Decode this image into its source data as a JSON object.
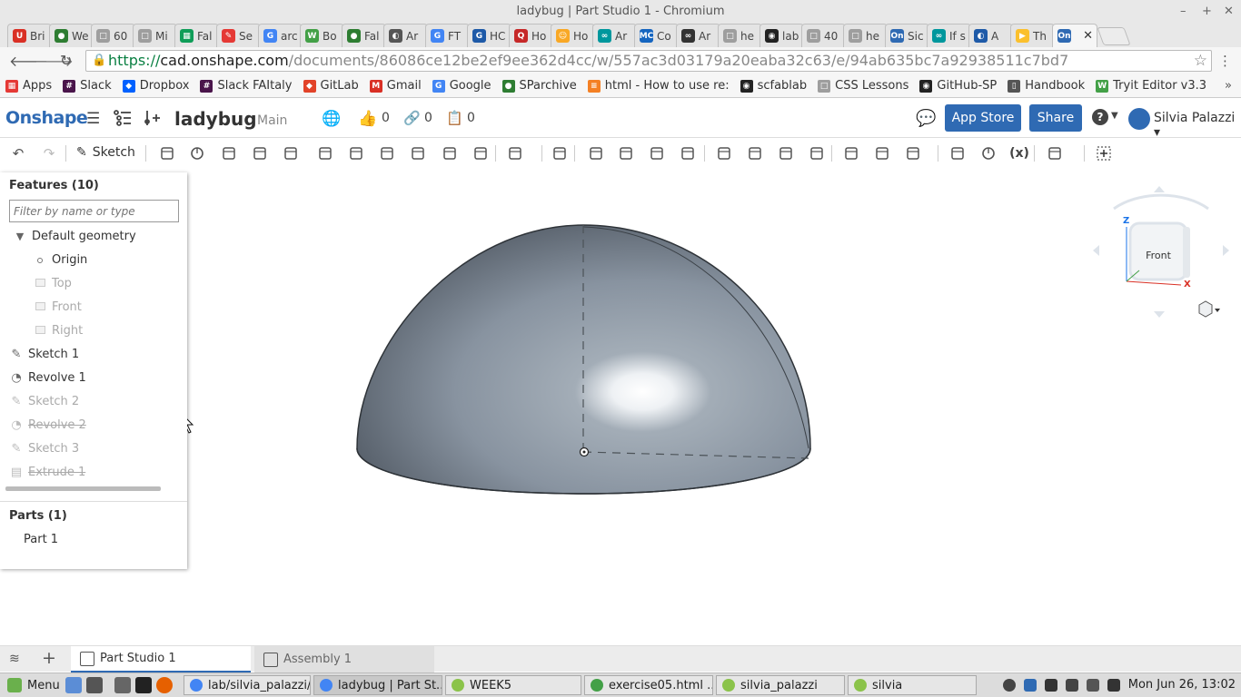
{
  "window": {
    "title": "ladybug | Part Studio 1 - Chromium"
  },
  "tabs": [
    {
      "label": "Bri",
      "color": "#d93025",
      "glyph": "U"
    },
    {
      "label": "We",
      "color": "#2e7d32",
      "glyph": "●"
    },
    {
      "label": "60",
      "color": "#9e9e9e",
      "glyph": "□"
    },
    {
      "label": "Mi",
      "color": "#9e9e9e",
      "glyph": "□"
    },
    {
      "label": "Fal",
      "color": "#0f9d58",
      "glyph": "▦"
    },
    {
      "label": "Se",
      "color": "#e53935",
      "glyph": "✎"
    },
    {
      "label": "arc",
      "color": "#4285f4",
      "glyph": "G"
    },
    {
      "label": "Bo",
      "color": "#43a047",
      "glyph": "W"
    },
    {
      "label": "Fal",
      "color": "#2e7d32",
      "glyph": "●"
    },
    {
      "label": "Ar",
      "color": "#555555",
      "glyph": "◐"
    },
    {
      "label": "FT",
      "color": "#4285f4",
      "glyph": "G"
    },
    {
      "label": "HC",
      "color": "#1e5aa8",
      "glyph": "G"
    },
    {
      "label": "Ho",
      "color": "#c62828",
      "glyph": "Q"
    },
    {
      "label": "Ho",
      "color": "#f9a825",
      "glyph": "☺"
    },
    {
      "label": "Ar",
      "color": "#00979d",
      "glyph": "∞"
    },
    {
      "label": "Co",
      "color": "#1565c0",
      "glyph": "MC"
    },
    {
      "label": "Ar",
      "color": "#333333",
      "glyph": "∞"
    },
    {
      "label": "he",
      "color": "#9e9e9e",
      "glyph": "□"
    },
    {
      "label": "lab",
      "color": "#222222",
      "glyph": "◉"
    },
    {
      "label": "40",
      "color": "#9e9e9e",
      "glyph": "□"
    },
    {
      "label": "he",
      "color": "#9e9e9e",
      "glyph": "□"
    },
    {
      "label": "Sic",
      "color": "#2f6ab3",
      "glyph": "On"
    },
    {
      "label": "If s",
      "color": "#00979d",
      "glyph": "∞"
    },
    {
      "label": "A",
      "color": "#1e5aa8",
      "glyph": "◐"
    },
    {
      "label": "Th",
      "color": "#fbc02d",
      "glyph": "▶"
    },
    {
      "label": "",
      "color": "#2f6ab3",
      "glyph": "On",
      "active": true
    }
  ],
  "address": {
    "scheme": "https://",
    "host": "cad.onshape.com",
    "path": "/documents/86086ce12be2ef9ee362d4cc/w/557ac3d03179a20eaba32c63/e/94ab635bc7a92938511c7bd7"
  },
  "bookmarks": [
    {
      "label": "Apps",
      "color": "#e53935",
      "glyph": "▦"
    },
    {
      "label": "Slack",
      "color": "#4a154b",
      "glyph": "#"
    },
    {
      "label": "Dropbox",
      "color": "#0061ff",
      "glyph": "◆"
    },
    {
      "label": "Slack FAItaly",
      "color": "#4a154b",
      "glyph": "#"
    },
    {
      "label": "GitLab",
      "color": "#e24329",
      "glyph": "◆"
    },
    {
      "label": "Gmail",
      "color": "#d93025",
      "glyph": "M"
    },
    {
      "label": "Google",
      "color": "#4285f4",
      "glyph": "G"
    },
    {
      "label": "SParchive",
      "color": "#2e7d32",
      "glyph": "●"
    },
    {
      "label": "html - How to use re:",
      "color": "#f48024",
      "glyph": "≡"
    },
    {
      "label": "scfablab",
      "color": "#222222",
      "glyph": "◉"
    },
    {
      "label": "CSS Lessons",
      "color": "#9e9e9e",
      "glyph": "□"
    },
    {
      "label": "GitHub-SP",
      "color": "#222222",
      "glyph": "◉"
    },
    {
      "label": "Handbook",
      "color": "#555555",
      "glyph": "▯"
    },
    {
      "label": "Tryit Editor v3.3",
      "color": "#43a047",
      "glyph": "W"
    }
  ],
  "header": {
    "logo": "Onshape",
    "document_name": "ladybug",
    "branch": "Main",
    "likes": "0",
    "links": "0",
    "copies": "0",
    "app_store": "App Store",
    "share": "Share",
    "help": "?",
    "user": "Silvia Palazzi"
  },
  "toolbar": {
    "sketch_label": "Sketch"
  },
  "features": {
    "title": "Features (10)",
    "filter_placeholder": "Filter by name or type",
    "default_geometry": "Default geometry",
    "items": [
      {
        "label": "Origin",
        "icon": "origin",
        "indent": 2,
        "dim": false,
        "strike": false
      },
      {
        "label": "Top",
        "icon": "plane",
        "indent": 2,
        "dim": true,
        "strike": false
      },
      {
        "label": "Front",
        "icon": "plane",
        "indent": 2,
        "dim": true,
        "strike": false
      },
      {
        "label": "Right",
        "icon": "plane",
        "indent": 2,
        "dim": true,
        "strike": false
      },
      {
        "label": "Sketch 1",
        "icon": "sketch",
        "indent": 0,
        "dim": false,
        "strike": false
      },
      {
        "label": "Revolve 1",
        "icon": "revolve",
        "indent": 0,
        "dim": false,
        "strike": false
      },
      {
        "label": "Sketch 2",
        "icon": "sketch",
        "indent": 0,
        "dim": true,
        "strike": false
      },
      {
        "label": "Revolve 2",
        "icon": "revolve",
        "indent": 0,
        "dim": true,
        "strike": true
      },
      {
        "label": "Sketch 3",
        "icon": "sketch",
        "indent": 0,
        "dim": true,
        "strike": false
      },
      {
        "label": "Extrude 1",
        "icon": "extrude",
        "indent": 0,
        "dim": true,
        "strike": true
      }
    ]
  },
  "parts": {
    "title": "Parts (1)",
    "items": [
      "Part 1"
    ]
  },
  "view_cube": {
    "face": "Front",
    "axis_z": "Z",
    "axis_x": "X"
  },
  "bottom_tabs": [
    {
      "label": "Part Studio 1",
      "active": true
    },
    {
      "label": "Assembly 1",
      "active": false
    }
  ],
  "taskbar": {
    "menu": "Menu",
    "tasks": [
      {
        "label": "lab/silvia_palazzi/...",
        "color": "#4285f4",
        "width": 140
      },
      {
        "label": "ladybug | Part St...",
        "color": "#4285f4",
        "width": 142,
        "active": true
      },
      {
        "label": "WEEK5",
        "color": "#8bc34a",
        "width": 150
      },
      {
        "label": "exercise05.html ...",
        "color": "#43a047",
        "width": 142
      },
      {
        "label": "silvia_palazzi",
        "color": "#8bc34a",
        "width": 142
      },
      {
        "label": "silvia",
        "color": "#8bc34a",
        "width": 142
      }
    ],
    "clock": "Mon Jun 26, 13:02"
  },
  "colors": {
    "accent": "#2f6ab3",
    "part": "#8a95a0"
  }
}
